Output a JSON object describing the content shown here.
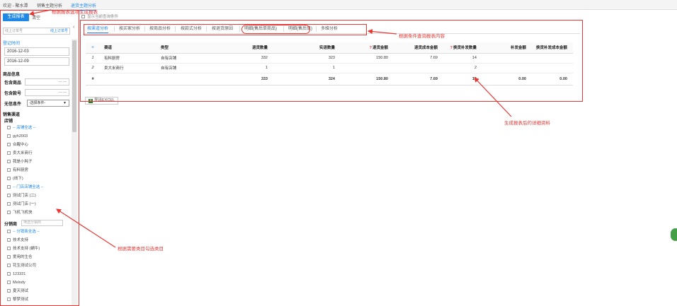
{
  "topbar": {
    "tabs": [
      "欢迎 - 聚水潭",
      "销售主题分析",
      "退货主题分析"
    ]
  },
  "sidebar": {
    "generate_button": "生成报表",
    "reset_button": "清空",
    "collapse_glyph": "‹",
    "order_select": {
      "placeholder": "线上订单号",
      "value": "线上订单号"
    },
    "register_time_title": "登记时间",
    "date_from": "2016-12-03",
    "date_to": "2016-12-09",
    "product_info_title": "商品信息",
    "include_product_label": "包含商品",
    "include_code_label": "包含款号",
    "no_info_label": "无信息件",
    "no_info_select": "-选择条件-",
    "channel_title": "销售渠道",
    "shop_label": "店铺",
    "shop_group": "-- 店铺全选 --",
    "shops": [
      "gyh2003",
      "合醒中心",
      "卖大米商行",
      "我是小耗子",
      "有料厨房",
      "(线下)"
    ],
    "store_group": "-- 门店店铺全选 --",
    "stores": [
      "测试门店 (二)",
      "测试门店 (一)",
      "飞机飞机快"
    ],
    "distributor_label": "分销商",
    "distributor_placeholder": "筛选分销商",
    "distributor_group": "-- 分销商全选 --",
    "distributors": [
      "技术支持",
      "技术支持 (蜗牛)",
      "爱用的生仓",
      "花生测试公司",
      "123321",
      "Melody",
      "夏天测试",
      "黎梦测试"
    ]
  },
  "main": {
    "hint": "显示当前查询条件",
    "tabs": [
      "按渠道分析",
      "按买家分析",
      "按商品分析",
      "按款式分析",
      "按退货原因",
      "明细(售后单商品)",
      "明细(售后单)",
      "多维分析"
    ],
    "active_tab": "按渠道分析",
    "table": {
      "headers": [
        "≡",
        "渠道",
        "类型",
        "退货数量",
        "实退数量",
        "退货金额",
        "退货成本金额",
        "换货补发数量",
        "补发金额",
        "换货补发成本金额"
      ],
      "rows": [
        [
          "1",
          "有料厨房",
          "自有店铺",
          "332",
          "323",
          "150.80",
          "7.69",
          "14",
          "",
          ""
        ],
        [
          "2",
          "卖大米商行",
          "自有店铺",
          "1",
          "1",
          "",
          "",
          "2",
          "",
          ""
        ]
      ],
      "total": [
        "#",
        "",
        "",
        "333",
        "324",
        "150.80",
        "7.69",
        "16",
        "0.00",
        "0.00"
      ]
    },
    "export_button": "导出EXCEL"
  },
  "annotations": {
    "sidebar_top": "根据报表选项生成报表",
    "tabs": "根据条件查询报表内容",
    "detail": "生成报表后的详细资料",
    "categories": "根据需要类目勾选类目"
  },
  "colors": {
    "accent": "#1e88e5",
    "annotation": "#e53935"
  }
}
